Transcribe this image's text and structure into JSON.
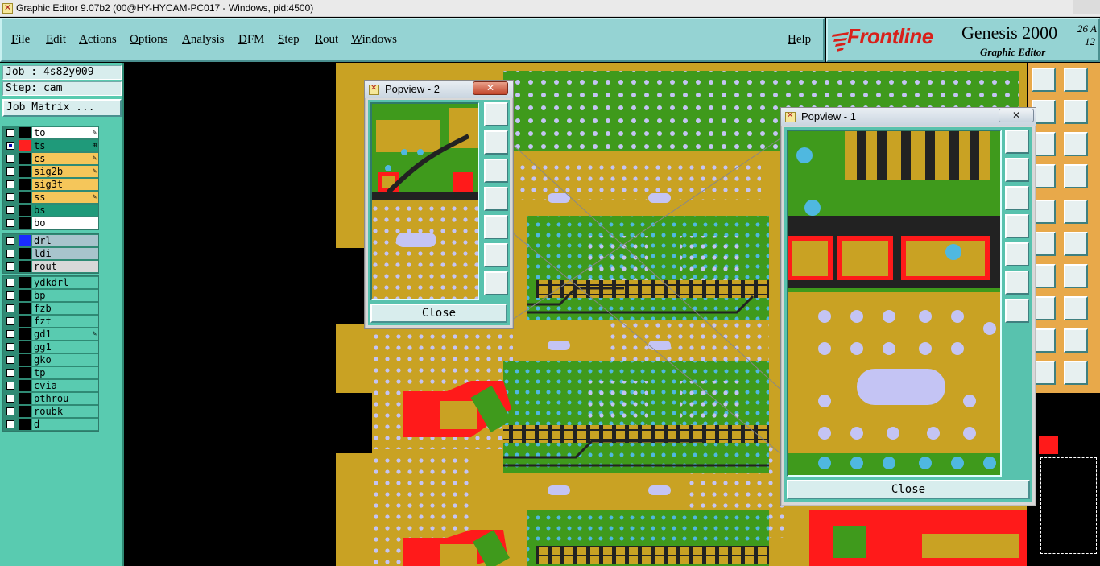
{
  "window": {
    "title": "Graphic Editor 9.07b2 (00@HY-HYCAM-PC017 - Windows, pid:4500)"
  },
  "menu": {
    "items": [
      {
        "mn": "F",
        "rest": "ile"
      },
      {
        "mn": "E",
        "rest": "dit"
      },
      {
        "mn": "A",
        "rest": "ctions"
      },
      {
        "mn": "O",
        "rest": "ptions"
      },
      {
        "mn": "A",
        "rest": "nalysis"
      },
      {
        "mn": "D",
        "rest": "FM"
      },
      {
        "mn": "S",
        "rest": "tep"
      },
      {
        "mn": "R",
        "rest": "out"
      },
      {
        "mn": "W",
        "rest": "indows"
      }
    ],
    "help": {
      "mn": "H",
      "rest": "elp"
    }
  },
  "brand": {
    "logo_text": "Frontline",
    "product": "Genesis 2000",
    "subtitle": "Graphic Editor",
    "date_line1": "26 A",
    "date_line2": "12"
  },
  "left_panel": {
    "job": "Job : 4s82y009",
    "step": "Step: cam",
    "job_matrix": "Job Matrix ..."
  },
  "layers": {
    "group1": [
      {
        "name": "to",
        "checked": false,
        "swatch": "#000000",
        "bg": "#ffffff",
        "mark": "✎"
      },
      {
        "name": "ts",
        "checked": true,
        "swatch": "#ff2020",
        "bg": "#1f9a7a",
        "mark": "⊞"
      },
      {
        "name": "cs",
        "checked": false,
        "swatch": "#000000",
        "bg": "#f5c65a",
        "mark": "✎"
      },
      {
        "name": "sig2b",
        "checked": false,
        "swatch": "#000000",
        "bg": "#f5c65a",
        "mark": "✎"
      },
      {
        "name": "sig3t",
        "checked": false,
        "swatch": "#000000",
        "bg": "#f5c65a",
        "mark": ""
      },
      {
        "name": "ss",
        "checked": false,
        "swatch": "#000000",
        "bg": "#f5c65a",
        "mark": "✎"
      },
      {
        "name": "bs",
        "checked": false,
        "swatch": "#000000",
        "bg": "#1f9a7a",
        "mark": ""
      },
      {
        "name": "bo",
        "checked": false,
        "swatch": "#000000",
        "bg": "#ffffff",
        "mark": ""
      }
    ],
    "group2": [
      {
        "name": "drl",
        "checked": false,
        "swatch": "#1a2cff",
        "bg": "#a8c4cc",
        "mark": ""
      },
      {
        "name": "ldi",
        "checked": false,
        "swatch": "#000000",
        "bg": "#a8c4cc",
        "mark": ""
      },
      {
        "name": "rout",
        "checked": false,
        "swatch": "#000000",
        "bg": "#d8d8d8",
        "mark": ""
      }
    ],
    "group3": [
      {
        "name": "ydkdrl",
        "checked": false,
        "swatch": "#000000",
        "bg": "#59cbb0",
        "mark": ""
      },
      {
        "name": "bp",
        "checked": false,
        "swatch": "#000000",
        "bg": "#59cbb0",
        "mark": ""
      },
      {
        "name": "fzb",
        "checked": false,
        "swatch": "#000000",
        "bg": "#59cbb0",
        "mark": ""
      },
      {
        "name": "fzt",
        "checked": false,
        "swatch": "#000000",
        "bg": "#59cbb0",
        "mark": ""
      },
      {
        "name": "gd1",
        "checked": false,
        "swatch": "#000000",
        "bg": "#59cbb0",
        "mark": "✎"
      },
      {
        "name": "gg1",
        "checked": false,
        "swatch": "#000000",
        "bg": "#59cbb0",
        "mark": ""
      },
      {
        "name": "gko",
        "checked": false,
        "swatch": "#000000",
        "bg": "#59cbb0",
        "mark": ""
      },
      {
        "name": "tp",
        "checked": false,
        "swatch": "#000000",
        "bg": "#59cbb0",
        "mark": ""
      },
      {
        "name": "cvia",
        "checked": false,
        "swatch": "#000000",
        "bg": "#59cbb0",
        "mark": ""
      },
      {
        "name": "pthrou",
        "checked": false,
        "swatch": "#000000",
        "bg": "#59cbb0",
        "mark": ""
      },
      {
        "name": "roubk",
        "checked": false,
        "swatch": "#000000",
        "bg": "#59cbb0",
        "mark": ""
      },
      {
        "name": "d",
        "checked": false,
        "swatch": "#000000",
        "bg": "#59cbb0",
        "mark": ""
      }
    ]
  },
  "popview2": {
    "title": "Popview - 2",
    "close_label": "Close",
    "x_label": "✕"
  },
  "popview1": {
    "title": "Popview - 1",
    "close_label": "Close",
    "x_label": "✕"
  },
  "colors": {
    "board": "#c9a223",
    "copper": "#c9a223",
    "mask": "#3f9a1c",
    "pad_red": "#ff1a1a",
    "via": "#4fb8e0",
    "hole": "#c4c4f4"
  }
}
